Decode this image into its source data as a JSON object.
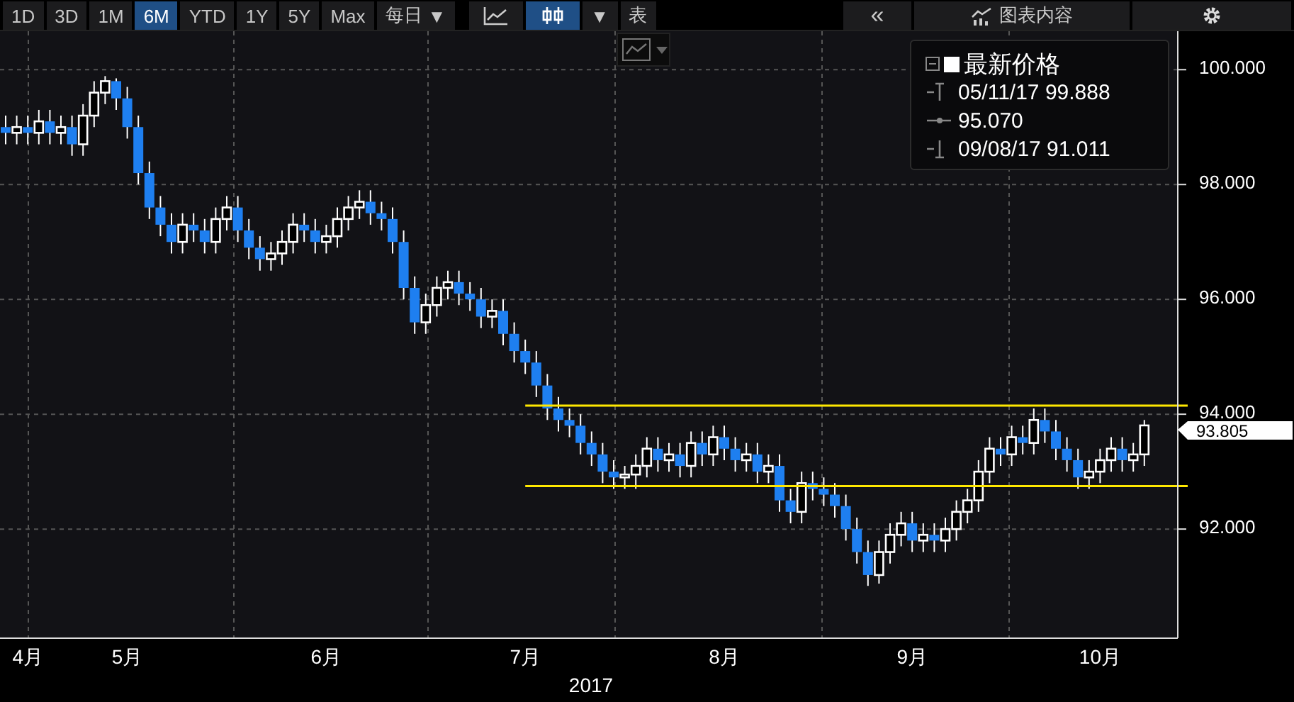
{
  "toolbar": {
    "periods": [
      {
        "label": "1D",
        "selected": false
      },
      {
        "label": "3D",
        "selected": false
      },
      {
        "label": "1M",
        "selected": false
      },
      {
        "label": "6M",
        "selected": true
      },
      {
        "label": "YTD",
        "selected": false
      },
      {
        "label": "1Y",
        "selected": false
      },
      {
        "label": "5Y",
        "selected": false
      },
      {
        "label": "Max",
        "selected": false
      }
    ],
    "frequency": {
      "label": "每日",
      "caret": "▼"
    },
    "chart_types": [
      {
        "kind": "line",
        "selected": false
      },
      {
        "kind": "candle",
        "selected": true
      }
    ],
    "chart_type_caret": "▼",
    "table_button": "表",
    "collapse_button": "«",
    "contents_button": "图表内容"
  },
  "legend": {
    "title": "最新价格",
    "items": [
      {
        "kind": "high",
        "text": "05/11/17 99.888"
      },
      {
        "kind": "average",
        "text": "95.070"
      },
      {
        "kind": "low",
        "text": "09/08/17 91.011"
      }
    ]
  },
  "last_price": "93.805",
  "chart_data": {
    "type": "candlestick",
    "xlabel": "2017",
    "ylim": [
      90.1,
      100.67
    ],
    "grid": true,
    "categories": [
      null,
      null,
      "4月",
      null,
      null,
      null,
      null,
      null,
      null,
      null,
      null,
      "5月",
      null,
      null,
      null,
      null,
      null,
      null,
      null,
      null,
      null,
      null,
      null,
      null,
      null,
      null,
      null,
      null,
      null,
      "6月",
      null,
      null,
      null,
      null,
      null,
      null,
      null,
      null,
      null,
      null,
      null,
      null,
      null,
      null,
      null,
      null,
      null,
      "7月",
      null,
      null,
      null,
      null,
      null,
      null,
      null,
      null,
      null,
      null,
      null,
      null,
      null,
      null,
      null,
      null,
      null,
      "8月",
      null,
      null,
      null,
      null,
      null,
      null,
      null,
      null,
      null,
      null,
      null,
      null,
      null,
      null,
      null,
      null,
      "9月",
      null,
      null,
      null,
      null,
      null,
      null,
      null,
      null,
      null,
      null,
      null,
      null,
      null,
      null,
      null,
      null,
      "10月",
      null,
      null,
      null,
      null
    ],
    "yticks": [
      {
        "value": 92,
        "label": "92.000"
      },
      {
        "value": 94,
        "label": "94.000"
      },
      {
        "value": 96,
        "label": "96.000"
      },
      {
        "value": 98,
        "label": "98.000"
      },
      {
        "value": 100,
        "label": "100.000"
      }
    ],
    "ohlc": [
      [
        99.0,
        99.2,
        98.7,
        98.9
      ],
      [
        98.9,
        99.2,
        98.7,
        99.0
      ],
      [
        99.0,
        99.2,
        98.7,
        98.9
      ],
      [
        98.9,
        99.3,
        98.7,
        99.1
      ],
      [
        99.1,
        99.3,
        98.7,
        98.9
      ],
      [
        98.9,
        99.2,
        98.7,
        99.0
      ],
      [
        99.0,
        99.2,
        98.5,
        98.7
      ],
      [
        98.7,
        99.4,
        98.5,
        99.2
      ],
      [
        99.2,
        99.8,
        99.0,
        99.6
      ],
      [
        99.6,
        99.888,
        99.4,
        99.8
      ],
      [
        99.8,
        99.85,
        99.3,
        99.5
      ],
      [
        99.5,
        99.7,
        98.8,
        99.0
      ],
      [
        99.0,
        99.2,
        98.0,
        98.2
      ],
      [
        98.2,
        98.4,
        97.4,
        97.6
      ],
      [
        97.6,
        97.8,
        97.1,
        97.3
      ],
      [
        97.3,
        97.5,
        96.8,
        97.0
      ],
      [
        97.0,
        97.5,
        96.8,
        97.3
      ],
      [
        97.3,
        97.5,
        97.0,
        97.2
      ],
      [
        97.2,
        97.4,
        96.8,
        97.0
      ],
      [
        97.0,
        97.6,
        96.8,
        97.4
      ],
      [
        97.4,
        97.8,
        97.2,
        97.6
      ],
      [
        97.6,
        97.8,
        97.0,
        97.2
      ],
      [
        97.2,
        97.4,
        96.7,
        96.9
      ],
      [
        96.9,
        97.1,
        96.5,
        96.7
      ],
      [
        96.7,
        97.0,
        96.5,
        96.8
      ],
      [
        96.8,
        97.2,
        96.6,
        97.0
      ],
      [
        97.0,
        97.5,
        96.8,
        97.3
      ],
      [
        97.3,
        97.5,
        97.0,
        97.2
      ],
      [
        97.2,
        97.4,
        96.8,
        97.0
      ],
      [
        97.0,
        97.3,
        96.8,
        97.1
      ],
      [
        97.1,
        97.6,
        96.9,
        97.4
      ],
      [
        97.4,
        97.8,
        97.2,
        97.6
      ],
      [
        97.6,
        97.9,
        97.4,
        97.7
      ],
      [
        97.7,
        97.9,
        97.3,
        97.5
      ],
      [
        97.5,
        97.7,
        97.2,
        97.4
      ],
      [
        97.4,
        97.6,
        96.8,
        97.0
      ],
      [
        97.0,
        97.2,
        96.0,
        96.2
      ],
      [
        96.2,
        96.4,
        95.4,
        95.6
      ],
      [
        95.6,
        96.1,
        95.4,
        95.9
      ],
      [
        95.9,
        96.4,
        95.7,
        96.2
      ],
      [
        96.2,
        96.5,
        96.0,
        96.3
      ],
      [
        96.3,
        96.5,
        95.9,
        96.1
      ],
      [
        96.1,
        96.3,
        95.8,
        96.0
      ],
      [
        96.0,
        96.2,
        95.5,
        95.7
      ],
      [
        95.7,
        96.0,
        95.5,
        95.8
      ],
      [
        95.8,
        96.0,
        95.2,
        95.4
      ],
      [
        95.4,
        95.6,
        94.9,
        95.1
      ],
      [
        95.1,
        95.3,
        94.7,
        94.9
      ],
      [
        94.9,
        95.1,
        94.3,
        94.5
      ],
      [
        94.5,
        94.7,
        93.9,
        94.1
      ],
      [
        94.1,
        94.3,
        93.7,
        93.9
      ],
      [
        93.9,
        94.1,
        93.6,
        93.8
      ],
      [
        93.8,
        94.0,
        93.3,
        93.5
      ],
      [
        93.5,
        93.7,
        93.1,
        93.3
      ],
      [
        93.3,
        93.5,
        92.8,
        93.0
      ],
      [
        93.0,
        93.2,
        92.7,
        92.9
      ],
      [
        92.9,
        93.1,
        92.7,
        92.95
      ],
      [
        92.95,
        93.3,
        92.7,
        93.1
      ],
      [
        93.1,
        93.6,
        92.9,
        93.4
      ],
      [
        93.4,
        93.6,
        93.0,
        93.2
      ],
      [
        93.2,
        93.5,
        93.0,
        93.3
      ],
      [
        93.3,
        93.5,
        92.9,
        93.1
      ],
      [
        93.1,
        93.7,
        92.9,
        93.5
      ],
      [
        93.5,
        93.7,
        93.1,
        93.3
      ],
      [
        93.3,
        93.8,
        93.1,
        93.6
      ],
      [
        93.6,
        93.8,
        93.2,
        93.4
      ],
      [
        93.4,
        93.6,
        93.0,
        93.2
      ],
      [
        93.2,
        93.5,
        93.0,
        93.3
      ],
      [
        93.3,
        93.5,
        92.8,
        93.0
      ],
      [
        93.0,
        93.3,
        92.8,
        93.1
      ],
      [
        93.1,
        93.3,
        92.3,
        92.5
      ],
      [
        92.5,
        92.7,
        92.1,
        92.3
      ],
      [
        92.3,
        93.0,
        92.1,
        92.8
      ],
      [
        92.8,
        93.0,
        92.5,
        92.7
      ],
      [
        92.7,
        92.9,
        92.4,
        92.6
      ],
      [
        92.6,
        92.8,
        92.2,
        92.4
      ],
      [
        92.4,
        92.6,
        91.8,
        92.0
      ],
      [
        92.0,
        92.2,
        91.4,
        91.6
      ],
      [
        91.6,
        91.8,
        91.011,
        91.2
      ],
      [
        91.2,
        91.8,
        91.05,
        91.6
      ],
      [
        91.6,
        92.1,
        91.4,
        91.9
      ],
      [
        91.9,
        92.3,
        91.7,
        92.1
      ],
      [
        92.1,
        92.3,
        91.6,
        91.8
      ],
      [
        91.8,
        92.1,
        91.6,
        91.9
      ],
      [
        91.9,
        92.1,
        91.6,
        91.8
      ],
      [
        91.8,
        92.2,
        91.6,
        92.0
      ],
      [
        92.0,
        92.5,
        91.8,
        92.3
      ],
      [
        92.3,
        92.7,
        92.1,
        92.5
      ],
      [
        92.5,
        93.2,
        92.3,
        93.0
      ],
      [
        93.0,
        93.6,
        92.8,
        93.4
      ],
      [
        93.4,
        93.6,
        93.1,
        93.3
      ],
      [
        93.3,
        93.8,
        93.1,
        93.6
      ],
      [
        93.6,
        93.8,
        93.3,
        93.5
      ],
      [
        93.5,
        94.1,
        93.3,
        93.9
      ],
      [
        93.9,
        94.1,
        93.5,
        93.7
      ],
      [
        93.7,
        93.9,
        93.2,
        93.4
      ],
      [
        93.4,
        93.6,
        93.0,
        93.2
      ],
      [
        93.2,
        93.4,
        92.7,
        92.9
      ],
      [
        92.9,
        93.2,
        92.7,
        93.0
      ],
      [
        93.0,
        93.4,
        92.8,
        93.2
      ],
      [
        93.2,
        93.6,
        93.0,
        93.4
      ],
      [
        93.4,
        93.6,
        93.0,
        93.2
      ],
      [
        93.2,
        93.5,
        93.0,
        93.3
      ],
      [
        93.3,
        93.9,
        93.1,
        93.805
      ]
    ],
    "ref_lines": [
      {
        "axis": "y",
        "value": 94.15,
        "color": "#ffe800"
      },
      {
        "axis": "y",
        "value": 92.75,
        "color": "#ffe800"
      }
    ]
  }
}
